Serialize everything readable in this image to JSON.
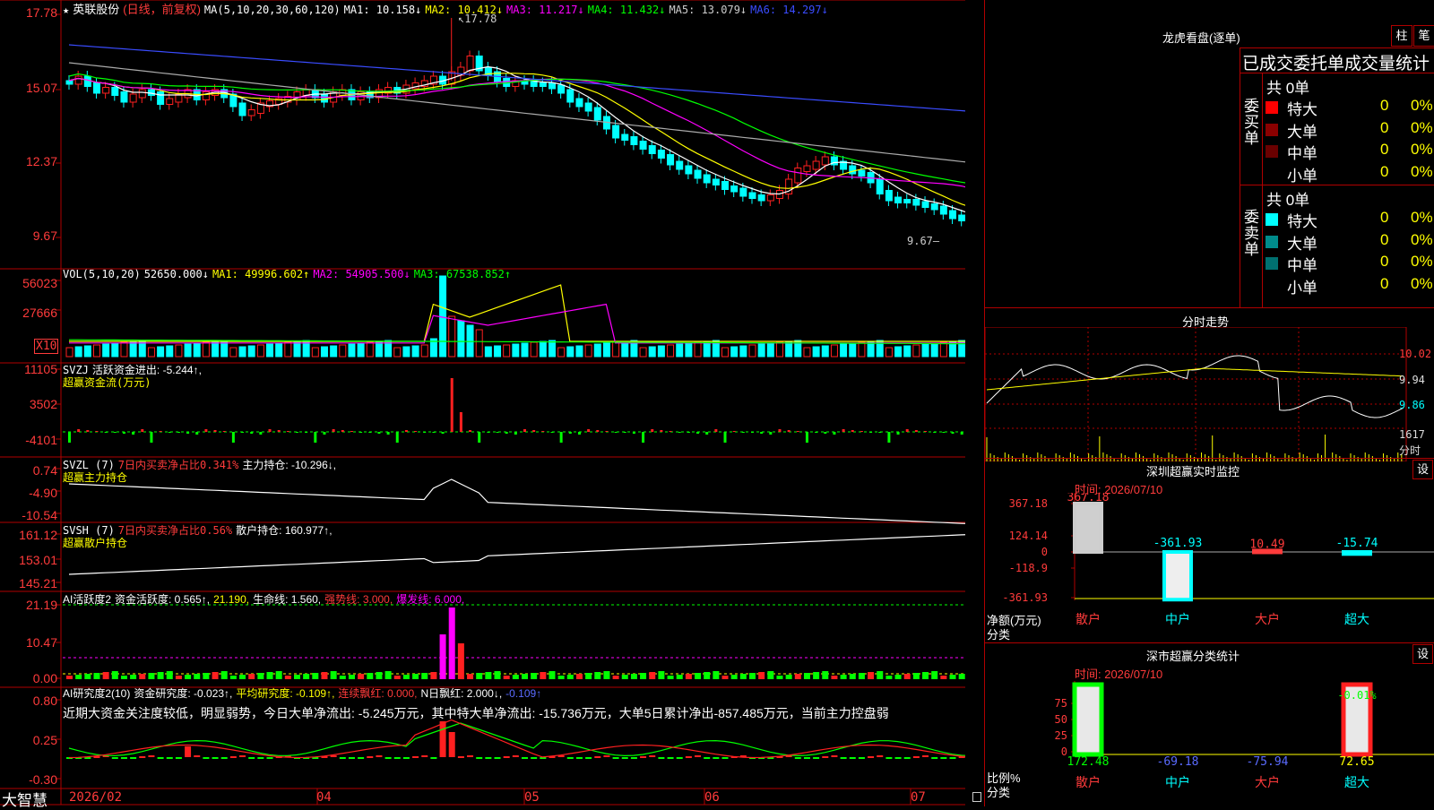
{
  "stock": {
    "name": "英联股份",
    "mode": "(日线，前复权)",
    "ma_label": "MA(5,10,20,30,60,120)",
    "ma": [
      {
        "label": "MA1:",
        "value": "10.158↓",
        "color": "#ffffff"
      },
      {
        "label": "MA2:",
        "value": "10.412↓",
        "color": "#ffff00"
      },
      {
        "label": "MA3:",
        "value": "11.217↓",
        "color": "#ff00ff"
      },
      {
        "label": "MA4:",
        "value": "11.432↓",
        "color": "#00ff00"
      },
      {
        "label": "MA5:",
        "value": "13.079↓",
        "color": "#cccccc"
      },
      {
        "label": "MA6:",
        "value": "14.297↓",
        "color": "#3a4cff"
      }
    ],
    "yticks": [
      "17.78",
      "15.07",
      "12.37",
      "9.67"
    ],
    "max_label": "17.78",
    "min_label": "9.67"
  },
  "vol": {
    "label": "VOL(5,10,20)",
    "value": "52650.000↓",
    "ma": [
      {
        "label": "MA1:",
        "value": "49996.602↑",
        "color": "#ffff00"
      },
      {
        "label": "MA2:",
        "value": "54905.500↓",
        "color": "#ff00ff"
      },
      {
        "label": "MA3:",
        "value": "67538.852↑",
        "color": "#00ff00"
      }
    ],
    "yticks": [
      "56023",
      "27666"
    ],
    "unit": "X10"
  },
  "svzj": {
    "label": "SVZJ",
    "desc": "活跃资金进出: -5.244↑,",
    "sub": "超赢资金流(万元)",
    "yticks": [
      "11105",
      "3502",
      "-4101"
    ]
  },
  "svzl": {
    "label": "SVZL (7)",
    "desc1": "7日内买卖净占比0.341%",
    "desc2": "主力持仓: -10.296↓,",
    "sub": "超赢主力持仓",
    "yticks": [
      "0.74",
      "-4.90",
      "-10.54"
    ]
  },
  "svsh": {
    "label": "SVSH (7)",
    "desc1": "7日内买卖净占比0.56%",
    "desc2": "散户持仓: 160.977↑,",
    "sub": "超赢散户持仓",
    "yticks": [
      "161.12",
      "153.01",
      "145.21"
    ]
  },
  "ai2": {
    "label": "AI活跃度2",
    "items": [
      {
        "text": "资金活跃度: 0.565↑,",
        "color": "#ffffff"
      },
      {
        "text": "21.190,",
        "color": "#ffff00"
      },
      {
        "text": "生命线: 1.560,",
        "color": "#ffffff"
      },
      {
        "text": "强势线: 3.000,",
        "color": "#ff3b3b"
      },
      {
        "text": "爆发线: 6.000,",
        "color": "#ff00ff"
      }
    ],
    "yticks": [
      "21.19",
      "10.47",
      "0.00"
    ]
  },
  "ai3": {
    "label": "AI研究度2(10)",
    "items": [
      {
        "text": "资金研究度: -0.023↑,",
        "color": "#ffffff"
      },
      {
        "text": "平均研究度: -0.109↑,",
        "color": "#ffff00"
      },
      {
        "text": "连续飘红: 0.000,",
        "color": "#ff3b3b"
      },
      {
        "text": "N日飘红: 2.000↓,",
        "color": "#ffffff"
      },
      {
        "text": "-0.109↑",
        "color": "#5a6bff"
      }
    ],
    "comment": "近期大资金关注度较低，明显弱势，今日大单净流出: -5.245万元，其中特大单净流出: -15.736万元，大单5日累计净出-857.485万元，当前主力控盘弱",
    "yticks": [
      "0.80",
      "0.25",
      "-0.30"
    ]
  },
  "xaxis": {
    "labels": [
      "2026/02",
      "04",
      "05",
      "06",
      "07"
    ]
  },
  "brand": "大智慧",
  "right": {
    "dragon_title": "龙虎看盘(逐单)",
    "btn_zhu": "柱",
    "btn_bi": "笔",
    "stats_title": "已成交委托单成交量统计",
    "buy": {
      "title": "委买单",
      "total": "共 0单",
      "rows": [
        {
          "name": "特大",
          "value": "0",
          "pct": "0%",
          "color": "#ff0000"
        },
        {
          "name": "大单",
          "value": "0",
          "pct": "0%",
          "color": "#8b0000"
        },
        {
          "name": "中单",
          "value": "0",
          "pct": "0%",
          "color": "#6a0000"
        },
        {
          "name": "小单",
          "value": "0",
          "pct": "0%",
          "color": "#000000"
        }
      ]
    },
    "sell": {
      "title": "委卖单",
      "total": "共 0单",
      "rows": [
        {
          "name": "特大",
          "value": "0",
          "pct": "0%",
          "color": "#00ffff"
        },
        {
          "name": "大单",
          "value": "0",
          "pct": "0%",
          "color": "#008b8b"
        },
        {
          "name": "中单",
          "value": "0",
          "pct": "0%",
          "color": "#007070"
        },
        {
          "name": "小单",
          "value": "0",
          "pct": "0%",
          "color": "#000000"
        }
      ]
    },
    "intraday": {
      "title": "分时走势",
      "yticks": [
        "10.02",
        "9.94",
        "9.86"
      ],
      "vol_label": "1617",
      "vol_unit": "分时"
    },
    "monitor": {
      "title": "深圳超赢实时监控",
      "btn": "设",
      "time": "时间: 2026/07/10",
      "yticks": [
        "367.18",
        "124.14",
        "0",
        "-118.9",
        "-361.93"
      ],
      "axis_label": "净额(万元)",
      "axis_label2": "分类",
      "cats": [
        "散户",
        "中户",
        "大户",
        "超大"
      ],
      "values": [
        "367.18",
        "-361.93",
        "10.49",
        "-15.74"
      ]
    },
    "classify": {
      "title": "深市超赢分类统计",
      "btn": "设",
      "time": "时间: 2026/07/10",
      "yticks": [
        "75",
        "50",
        "25",
        "0"
      ],
      "axis_label": "比例%",
      "axis_label2": "分类",
      "cats": [
        "散户",
        "中户",
        "大户",
        "超大"
      ],
      "values": [
        "172.48",
        "-69.18",
        "-75.94",
        "72.65"
      ],
      "top_label": "-0.01%"
    }
  },
  "colors": {
    "up": "#ff2020",
    "down": "#00ffff",
    "grid": "#b00000"
  }
}
